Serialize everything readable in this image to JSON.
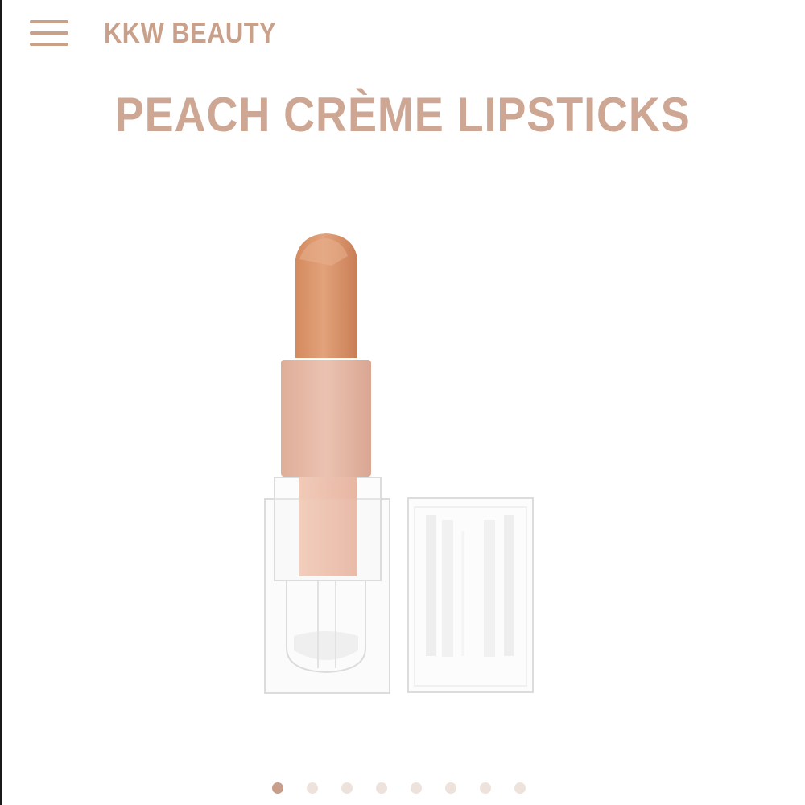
{
  "header": {
    "brand": "KKW BEAUTY"
  },
  "product": {
    "title": "PEACH CRÈME LIPSTICKS"
  },
  "carousel": {
    "slide_count": 8,
    "active_index": 0
  },
  "colors": {
    "accent": "#c9a18a",
    "title": "#cda794",
    "dot_active": "#c89e8a",
    "dot_inactive": "#ede2dc",
    "lipstick_bullet": "#d78e63",
    "lipstick_sleeve": "#e3b6a3"
  }
}
